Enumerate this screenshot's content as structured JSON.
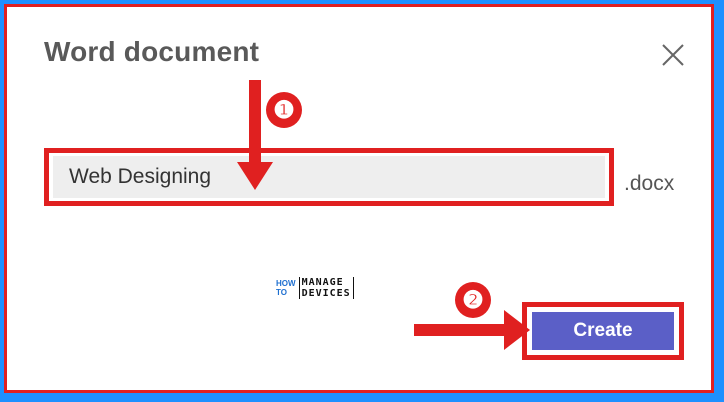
{
  "dialog": {
    "title": "Word document",
    "close_icon": "close-icon",
    "filename_value": "Web Designing",
    "extension": ".docx",
    "create_label": "Create"
  },
  "annotations": {
    "step1": "❶",
    "step2": "❷",
    "accent_color": "#e02020",
    "button_color": "#5b5fc7",
    "background_color": "#1e90ff"
  },
  "watermark": {
    "how": "HOW",
    "to": "TO",
    "manage": "MANAGE",
    "devices": "DEVICES"
  }
}
